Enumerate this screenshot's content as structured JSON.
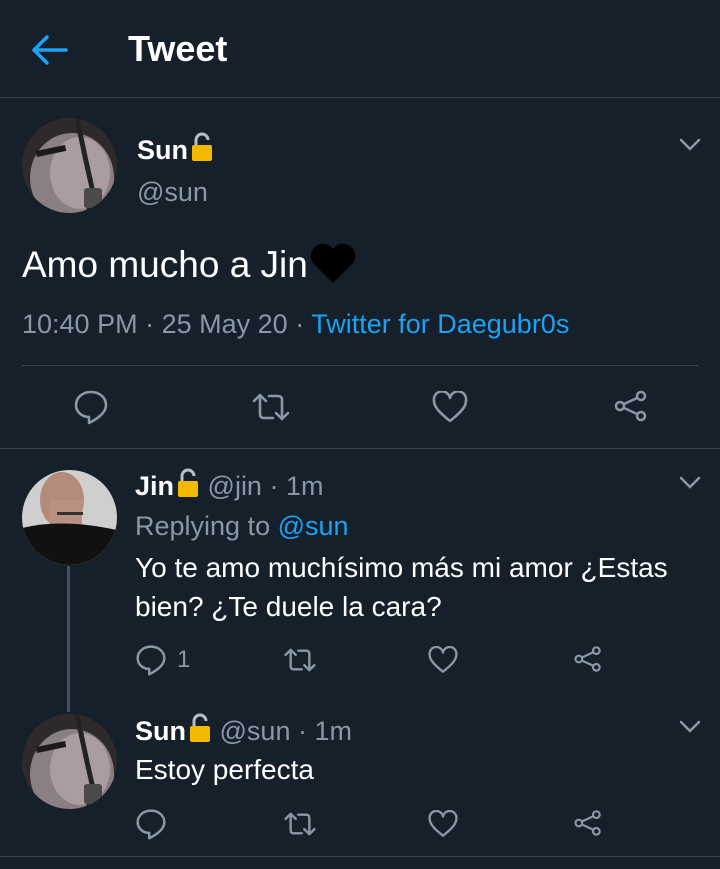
{
  "header": {
    "title": "Tweet",
    "back_icon": "back-arrow-icon"
  },
  "main_tweet": {
    "name": "Sun",
    "handle": "@sun",
    "text": "Amo mucho a Jin",
    "emoji": "black-heart",
    "time": "10:40 PM",
    "sep1": "·",
    "date": "25 May 20",
    "sep2": "·",
    "source": "Twitter for Daegubr0s"
  },
  "reply1": {
    "name": "Jin",
    "handle": "@jin",
    "sep": "·",
    "time": "1m",
    "replying_label": "Replying to",
    "replying_handle": "@sun",
    "text_line1": "Yo te amo muchísimo más mi amor ¿Estas",
    "text_line2": "bien? ¿Te duele la cara?",
    "reply_count": "1"
  },
  "reply2": {
    "name": "Sun",
    "handle": "@sun",
    "sep": "·",
    "time": "1m",
    "text": "Estoy perfecta"
  },
  "colors": {
    "background": "#15202b",
    "accent": "#1da1f2",
    "muted": "#8899a6",
    "divider": "#38444d",
    "lock": "#f5b800"
  }
}
